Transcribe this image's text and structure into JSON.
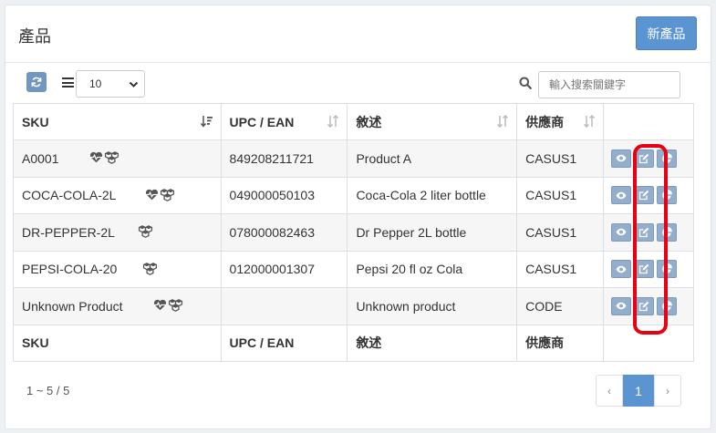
{
  "header": {
    "title": "產品",
    "new_button": "新產品"
  },
  "toolbar": {
    "page_size": "10",
    "search_placeholder": "輸入搜索關鍵字"
  },
  "table": {
    "columns": [
      "SKU",
      "UPC / EAN",
      "敘述",
      "供應商"
    ],
    "rows": [
      {
        "sku": "A0001",
        "upc": "849208211721",
        "desc": "Product A",
        "vendor": "CASUS1",
        "icons": [
          "heartbeat-icon",
          "cubes-icon"
        ]
      },
      {
        "sku": "COCA-COLA-2L",
        "upc": "049000050103",
        "desc": "Coca-Cola 2 liter bottle",
        "vendor": "CASUS1",
        "icons": [
          "heartbeat-icon",
          "cubes-icon"
        ]
      },
      {
        "sku": "DR-PEPPER-2L",
        "upc": "078000082463",
        "desc": "Dr Pepper 2L bottle",
        "vendor": "CASUS1",
        "icons": [
          "cubes-icon"
        ]
      },
      {
        "sku": "PEPSI-COLA-20",
        "upc": "012000001307",
        "desc": "Pepsi 20 fl oz Cola",
        "vendor": "CASUS1",
        "icons": [
          "cubes-icon"
        ]
      },
      {
        "sku": "Unknown Product",
        "upc": "",
        "desc": "Unknown product",
        "vendor": "CODE",
        "icons": [
          "heartbeat-icon",
          "cubes-icon"
        ]
      }
    ]
  },
  "footer": {
    "count": "1 ~ 5 / 5",
    "prev": "‹",
    "page": "1",
    "next": "›"
  },
  "colors": {
    "primary": "#5b95d1",
    "action_button": "#93aecb",
    "highlight": "#e60012"
  }
}
